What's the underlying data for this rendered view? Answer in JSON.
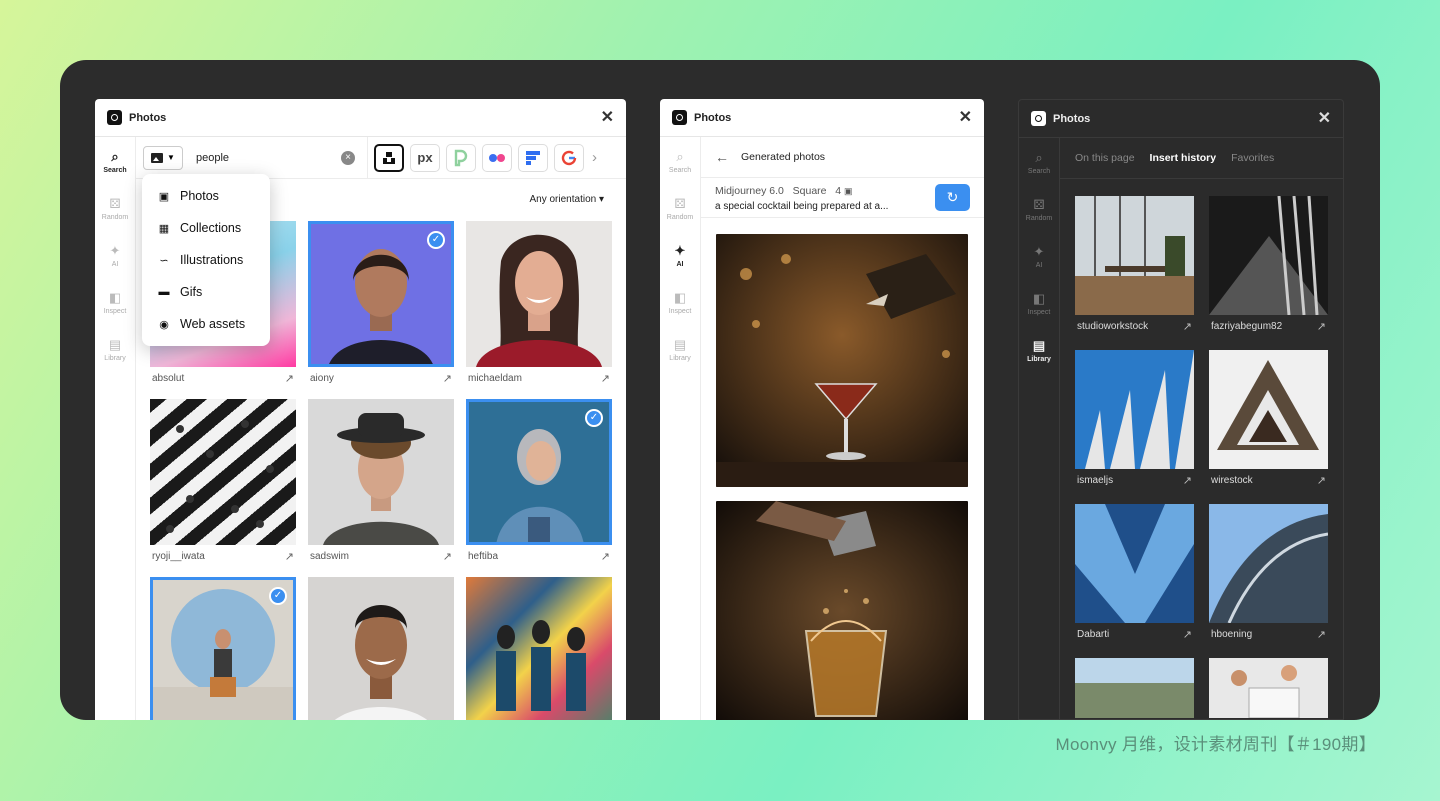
{
  "caption": "Moonvy 月维，设计素材周刊【＃190期】",
  "rail": [
    {
      "label": "Search",
      "icon": "search-icon"
    },
    {
      "label": "Random",
      "icon": "dice-icon"
    },
    {
      "label": "AI",
      "icon": "sparkle-icon"
    },
    {
      "label": "Inspect",
      "icon": "inspect-icon"
    },
    {
      "label": "Library",
      "icon": "library-icon"
    }
  ],
  "panel1": {
    "title": "Photos",
    "search_value": "people",
    "sources": [
      "",
      "px",
      "",
      "",
      "",
      "",
      ""
    ],
    "orientation": "Any orientation ▾",
    "menu": [
      "Photos",
      "Collections",
      "Illustrations",
      "Gifs",
      "Web assets"
    ],
    "cells": [
      {
        "name": "absolut",
        "selected": false
      },
      {
        "name": "aiony",
        "selected": true
      },
      {
        "name": "michaeldam",
        "selected": false
      },
      {
        "name": "ryoji__iwata",
        "selected": false
      },
      {
        "name": "sadswim",
        "selected": false
      },
      {
        "name": "heftiba",
        "selected": true
      },
      {
        "name": "",
        "selected": true
      },
      {
        "name": "",
        "selected": false
      },
      {
        "name": "",
        "selected": false
      }
    ]
  },
  "panel2": {
    "title": "Photos",
    "header": "Generated photos",
    "meta_model": "Midjourney 6.0",
    "meta_ratio": "Square",
    "meta_count": "4",
    "prompt": "a special cocktail being prepared at a..."
  },
  "panel3": {
    "title": "Photos",
    "tabs": [
      "On this page",
      "Insert history",
      "Favorites"
    ],
    "cells": [
      "studioworkstock",
      "fazriyabegum82",
      "ismaeljs",
      "wirestock",
      "Dabarti",
      "hboening",
      "",
      ""
    ]
  },
  "colors": {
    "accent": "#3b8ff0",
    "stage": "#2c2c2c"
  }
}
